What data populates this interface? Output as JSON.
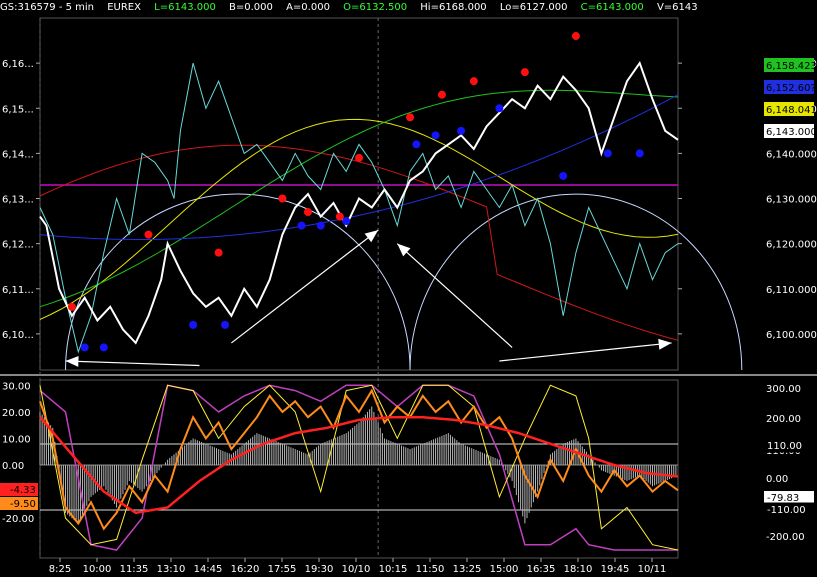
{
  "header": {
    "symbol": "GS:316579 - 5 min",
    "exchange": "EUREX",
    "last": "L=6143.000",
    "bid": "B=0.000",
    "ask": "A=0.000",
    "open": "O=6132.500",
    "high": "Hi=6168.000",
    "low": "Lo=6127.000",
    "close": "C=6143.000",
    "volume": "V=6143"
  },
  "colors": {
    "background": "#000000",
    "price": "#ffffff",
    "close_line": "#66d9d9",
    "red_ma": "#d01818",
    "yellow_ma": "#e6e600",
    "green_ma": "#1fc21f",
    "blue_ma": "#2030e0",
    "magenta_line": "#c010c0",
    "arc": "#c8d8ff",
    "dot_red": "#ff1010",
    "dot_blue": "#1414ff",
    "osc_histogram": "#b8b8b8",
    "osc_orange": "#ff8c1a",
    "osc_yellow": "#ffee33",
    "osc_red": "#ff2020",
    "osc_magenta": "#c040c0",
    "osc_white": "#ffffff"
  },
  "chart_data": [
    {
      "type": "line",
      "panel": "price",
      "ylim": [
        6092,
        6170
      ],
      "y_ticks": [
        6100,
        6110,
        6120,
        6130,
        6140,
        6150,
        6160
      ],
      "y_tick_labels_left": [
        "6,10...",
        "6,11...",
        "6,12...",
        "6,13...",
        "6,14...",
        "6,15...",
        "6,16..."
      ],
      "y_tick_labels_right": [
        "6,100.000",
        "6,110.000",
        "6,120.000",
        "6,130.000",
        "6,140.000",
        "6,150.000",
        "6,160.000"
      ],
      "price_badges": [
        {
          "label": "6,158.423",
          "value": 6158.4,
          "color": "#1fc21f"
        },
        {
          "label": "6,152.60?",
          "value": 6152.6,
          "color": "#2030e0"
        },
        {
          "label": "6,148.041",
          "value": 6148.0,
          "color": "#e6e600"
        },
        {
          "label": "6,143.000",
          "value": 6143.0,
          "color": "#ffffff"
        }
      ],
      "x_tick_labels": [
        "8:25",
        "10:00",
        "11:35",
        "13:10",
        "14:45",
        "16:20",
        "17:55",
        "19:30",
        "10/10",
        "10:15",
        "11:50",
        "13:25",
        "15:00",
        "16:35",
        "18:10",
        "19:45",
        "10/11"
      ],
      "horizontal_line": 6133,
      "price_series": [
        [
          0.0,
          6126
        ],
        [
          0.01,
          6124
        ],
        [
          0.03,
          6110
        ],
        [
          0.05,
          6104
        ],
        [
          0.07,
          6108
        ],
        [
          0.09,
          6103
        ],
        [
          0.11,
          6106
        ],
        [
          0.13,
          6101
        ],
        [
          0.15,
          6098
        ],
        [
          0.17,
          6104
        ],
        [
          0.19,
          6112
        ],
        [
          0.2,
          6120
        ],
        [
          0.22,
          6114
        ],
        [
          0.24,
          6109
        ],
        [
          0.26,
          6106
        ],
        [
          0.28,
          6108
        ],
        [
          0.3,
          6104
        ],
        [
          0.32,
          6110
        ],
        [
          0.34,
          6106
        ],
        [
          0.36,
          6112
        ],
        [
          0.38,
          6122
        ],
        [
          0.4,
          6128
        ],
        [
          0.42,
          6131
        ],
        [
          0.44,
          6126
        ],
        [
          0.46,
          6129
        ],
        [
          0.48,
          6124
        ],
        [
          0.5,
          6130
        ],
        [
          0.52,
          6128
        ],
        [
          0.54,
          6132
        ],
        [
          0.56,
          6128
        ],
        [
          0.58,
          6134
        ],
        [
          0.6,
          6136
        ],
        [
          0.62,
          6140
        ],
        [
          0.64,
          6142
        ],
        [
          0.66,
          6144
        ],
        [
          0.68,
          6141
        ],
        [
          0.7,
          6146
        ],
        [
          0.72,
          6149
        ],
        [
          0.74,
          6152
        ],
        [
          0.76,
          6150
        ],
        [
          0.78,
          6155
        ],
        [
          0.8,
          6152
        ],
        [
          0.82,
          6157
        ],
        [
          0.84,
          6154
        ],
        [
          0.86,
          6150
        ],
        [
          0.88,
          6140
        ],
        [
          0.9,
          6148
        ],
        [
          0.92,
          6156
        ],
        [
          0.94,
          6160
        ],
        [
          0.96,
          6152
        ],
        [
          0.98,
          6145
        ],
        [
          1.0,
          6143
        ]
      ],
      "cyan_series": [
        [
          0.0,
          6128
        ],
        [
          0.02,
          6122
        ],
        [
          0.04,
          6108
        ],
        [
          0.06,
          6096
        ],
        [
          0.08,
          6104
        ],
        [
          0.1,
          6118
        ],
        [
          0.12,
          6130
        ],
        [
          0.14,
          6122
        ],
        [
          0.16,
          6140
        ],
        [
          0.18,
          6138
        ],
        [
          0.2,
          6134
        ],
        [
          0.21,
          6130
        ],
        [
          0.22,
          6145
        ],
        [
          0.24,
          6160
        ],
        [
          0.26,
          6150
        ],
        [
          0.28,
          6156
        ],
        [
          0.3,
          6148
        ],
        [
          0.32,
          6140
        ],
        [
          0.34,
          6142
        ],
        [
          0.36,
          6138
        ],
        [
          0.38,
          6134
        ],
        [
          0.4,
          6140
        ],
        [
          0.42,
          6135
        ],
        [
          0.44,
          6132
        ],
        [
          0.46,
          6140
        ],
        [
          0.48,
          6136
        ],
        [
          0.5,
          6142
        ],
        [
          0.52,
          6138
        ],
        [
          0.54,
          6132
        ],
        [
          0.56,
          6124
        ],
        [
          0.58,
          6136
        ],
        [
          0.6,
          6140
        ],
        [
          0.62,
          6132
        ],
        [
          0.64,
          6135
        ],
        [
          0.66,
          6128
        ],
        [
          0.68,
          6136
        ],
        [
          0.7,
          6132
        ],
        [
          0.72,
          6128
        ],
        [
          0.74,
          6133
        ],
        [
          0.76,
          6124
        ],
        [
          0.78,
          6130
        ],
        [
          0.8,
          6120
        ],
        [
          0.82,
          6104
        ],
        [
          0.84,
          6118
        ],
        [
          0.86,
          6128
        ],
        [
          0.88,
          6122
        ],
        [
          0.9,
          6116
        ],
        [
          0.92,
          6110
        ],
        [
          0.94,
          6120
        ],
        [
          0.96,
          6112
        ],
        [
          0.98,
          6118
        ],
        [
          1.0,
          6120
        ]
      ],
      "red_dots": [
        [
          0.05,
          6106
        ],
        [
          0.17,
          6122
        ],
        [
          0.28,
          6118
        ],
        [
          0.38,
          6130
        ],
        [
          0.42,
          6127
        ],
        [
          0.47,
          6126
        ],
        [
          0.5,
          6139
        ],
        [
          0.58,
          6148
        ],
        [
          0.63,
          6153
        ],
        [
          0.68,
          6156
        ],
        [
          0.76,
          6158
        ],
        [
          0.84,
          6166
        ]
      ],
      "blue_dots": [
        [
          0.07,
          6097
        ],
        [
          0.1,
          6097
        ],
        [
          0.24,
          6102
        ],
        [
          0.29,
          6102
        ],
        [
          0.41,
          6124
        ],
        [
          0.44,
          6124
        ],
        [
          0.48,
          6125
        ],
        [
          0.59,
          6142
        ],
        [
          0.62,
          6144
        ],
        [
          0.66,
          6145
        ],
        [
          0.72,
          6150
        ],
        [
          0.82,
          6135
        ],
        [
          0.89,
          6140
        ],
        [
          0.94,
          6140
        ]
      ],
      "arrows": [
        {
          "from": [
            0.25,
            6093
          ],
          "to": [
            0.04,
            6094
          ]
        },
        {
          "from": [
            0.3,
            6098
          ],
          "to": [
            0.53,
            6123
          ]
        },
        {
          "from": [
            0.74,
            6097
          ],
          "to": [
            0.56,
            6120
          ]
        },
        {
          "from": [
            0.72,
            6094
          ],
          "to": [
            0.99,
            6098
          ]
        }
      ]
    },
    {
      "type": "line",
      "panel": "oscillator",
      "ylim_left": [
        -35,
        32
      ],
      "y_ticks_left": [
        30,
        20,
        10,
        0,
        -10,
        -20
      ],
      "y_tick_labels_left": [
        "30.00",
        "20.00",
        "10.00",
        "0.00",
        "-10.00",
        "-20.00"
      ],
      "y_tick_labels_right": [
        "300.00",
        "200.00",
        "110.00",
        "0.00",
        "-110.00",
        "-200.00"
      ],
      "badges_left": [
        {
          "label": "-4.33",
          "value": -4.33,
          "color": "#ff2020"
        },
        {
          "label": "-9.50",
          "value": -9.5,
          "color": "#ff8c1a"
        }
      ],
      "badges_right": [
        {
          "label": "110.00",
          "value": 110
        },
        {
          "label": "-79.83",
          "value": -79.83
        },
        {
          "label": "-110.00",
          "value": -110
        }
      ],
      "hlines_right": [
        110,
        -110
      ],
      "orange_series": [
        [
          0.0,
          24
        ],
        [
          0.02,
          10
        ],
        [
          0.04,
          -16
        ],
        [
          0.06,
          -22
        ],
        [
          0.08,
          -14
        ],
        [
          0.1,
          -24
        ],
        [
          0.12,
          -18
        ],
        [
          0.14,
          -8
        ],
        [
          0.16,
          -14
        ],
        [
          0.18,
          -4
        ],
        [
          0.2,
          -10
        ],
        [
          0.22,
          6
        ],
        [
          0.24,
          18
        ],
        [
          0.26,
          10
        ],
        [
          0.28,
          16
        ],
        [
          0.3,
          6
        ],
        [
          0.32,
          12
        ],
        [
          0.34,
          18
        ],
        [
          0.36,
          26
        ],
        [
          0.38,
          20
        ],
        [
          0.4,
          24
        ],
        [
          0.42,
          18
        ],
        [
          0.44,
          22
        ],
        [
          0.46,
          14
        ],
        [
          0.48,
          26
        ],
        [
          0.5,
          20
        ],
        [
          0.52,
          28
        ],
        [
          0.54,
          16
        ],
        [
          0.56,
          22
        ],
        [
          0.58,
          18
        ],
        [
          0.6,
          26
        ],
        [
          0.62,
          20
        ],
        [
          0.64,
          24
        ],
        [
          0.66,
          16
        ],
        [
          0.68,
          22
        ],
        [
          0.7,
          14
        ],
        [
          0.72,
          18
        ],
        [
          0.74,
          10
        ],
        [
          0.76,
          -4
        ],
        [
          0.78,
          -12
        ],
        [
          0.8,
          2
        ],
        [
          0.82,
          -6
        ],
        [
          0.84,
          6
        ],
        [
          0.86,
          -4
        ],
        [
          0.88,
          -10
        ],
        [
          0.9,
          -2
        ],
        [
          0.92,
          -8
        ],
        [
          0.94,
          -4
        ],
        [
          0.96,
          -10
        ],
        [
          0.98,
          -6
        ],
        [
          1.0,
          -9.5
        ]
      ],
      "red_series": [
        [
          0.0,
          18
        ],
        [
          0.05,
          4
        ],
        [
          0.1,
          -10
        ],
        [
          0.15,
          -18
        ],
        [
          0.2,
          -16
        ],
        [
          0.25,
          -6
        ],
        [
          0.3,
          2
        ],
        [
          0.35,
          8
        ],
        [
          0.4,
          12
        ],
        [
          0.45,
          14
        ],
        [
          0.5,
          17
        ],
        [
          0.55,
          18
        ],
        [
          0.6,
          18
        ],
        [
          0.65,
          17
        ],
        [
          0.7,
          15
        ],
        [
          0.75,
          12
        ],
        [
          0.8,
          8
        ],
        [
          0.85,
          4
        ],
        [
          0.9,
          0
        ],
        [
          0.95,
          -3
        ],
        [
          1.0,
          -4.33
        ]
      ],
      "histogram": [
        [
          0.0,
          20
        ],
        [
          0.02,
          14
        ],
        [
          0.04,
          -18
        ],
        [
          0.06,
          -22
        ],
        [
          0.08,
          -12
        ],
        [
          0.1,
          -8
        ],
        [
          0.12,
          -16
        ],
        [
          0.14,
          -6
        ],
        [
          0.16,
          -10
        ],
        [
          0.18,
          -4
        ],
        [
          0.2,
          2
        ],
        [
          0.22,
          6
        ],
        [
          0.24,
          10
        ],
        [
          0.26,
          8
        ],
        [
          0.28,
          6
        ],
        [
          0.3,
          4
        ],
        [
          0.32,
          8
        ],
        [
          0.34,
          12
        ],
        [
          0.36,
          10
        ],
        [
          0.38,
          8
        ],
        [
          0.4,
          6
        ],
        [
          0.42,
          4
        ],
        [
          0.44,
          8
        ],
        [
          0.46,
          10
        ],
        [
          0.48,
          12
        ],
        [
          0.5,
          16
        ],
        [
          0.52,
          22
        ],
        [
          0.54,
          10
        ],
        [
          0.56,
          8
        ],
        [
          0.58,
          6
        ],
        [
          0.6,
          8
        ],
        [
          0.62,
          10
        ],
        [
          0.64,
          12
        ],
        [
          0.66,
          8
        ],
        [
          0.68,
          6
        ],
        [
          0.7,
          4
        ],
        [
          0.72,
          2
        ],
        [
          0.74,
          -6
        ],
        [
          0.76,
          -22
        ],
        [
          0.78,
          -10
        ],
        [
          0.8,
          4
        ],
        [
          0.82,
          8
        ],
        [
          0.84,
          10
        ],
        [
          0.86,
          4
        ],
        [
          0.88,
          -2
        ],
        [
          0.9,
          -4
        ],
        [
          0.92,
          -6
        ],
        [
          0.94,
          -4
        ],
        [
          0.96,
          -8
        ],
        [
          0.98,
          -6
        ],
        [
          1.0,
          -4
        ]
      ],
      "yellow_series": [
        [
          0.0,
          30
        ],
        [
          0.04,
          -20
        ],
        [
          0.08,
          -30
        ],
        [
          0.12,
          -28
        ],
        [
          0.16,
          2
        ],
        [
          0.2,
          30
        ],
        [
          0.24,
          28
        ],
        [
          0.28,
          10
        ],
        [
          0.32,
          22
        ],
        [
          0.36,
          30
        ],
        [
          0.4,
          20
        ],
        [
          0.44,
          -10
        ],
        [
          0.48,
          28
        ],
        [
          0.52,
          30
        ],
        [
          0.56,
          10
        ],
        [
          0.6,
          30
        ],
        [
          0.64,
          30
        ],
        [
          0.68,
          22
        ],
        [
          0.72,
          -12
        ],
        [
          0.76,
          10
        ],
        [
          0.8,
          30
        ],
        [
          0.84,
          26
        ],
        [
          0.86,
          10
        ],
        [
          0.88,
          -24
        ],
        [
          0.92,
          -16
        ],
        [
          0.96,
          -30
        ],
        [
          1.0,
          -32
        ]
      ],
      "magenta_series": [
        [
          0.0,
          28
        ],
        [
          0.04,
          20
        ],
        [
          0.08,
          -30
        ],
        [
          0.12,
          -32
        ],
        [
          0.16,
          -20
        ],
        [
          0.2,
          30
        ],
        [
          0.24,
          28
        ],
        [
          0.28,
          20
        ],
        [
          0.32,
          26
        ],
        [
          0.36,
          30
        ],
        [
          0.4,
          28
        ],
        [
          0.44,
          24
        ],
        [
          0.48,
          30
        ],
        [
          0.52,
          30
        ],
        [
          0.56,
          22
        ],
        [
          0.6,
          30
        ],
        [
          0.64,
          30
        ],
        [
          0.68,
          26
        ],
        [
          0.72,
          4
        ],
        [
          0.76,
          -30
        ],
        [
          0.8,
          -30
        ],
        [
          0.84,
          -24
        ],
        [
          0.86,
          -30
        ],
        [
          0.9,
          -32
        ],
        [
          0.95,
          -32
        ],
        [
          1.0,
          -32
        ]
      ]
    }
  ]
}
